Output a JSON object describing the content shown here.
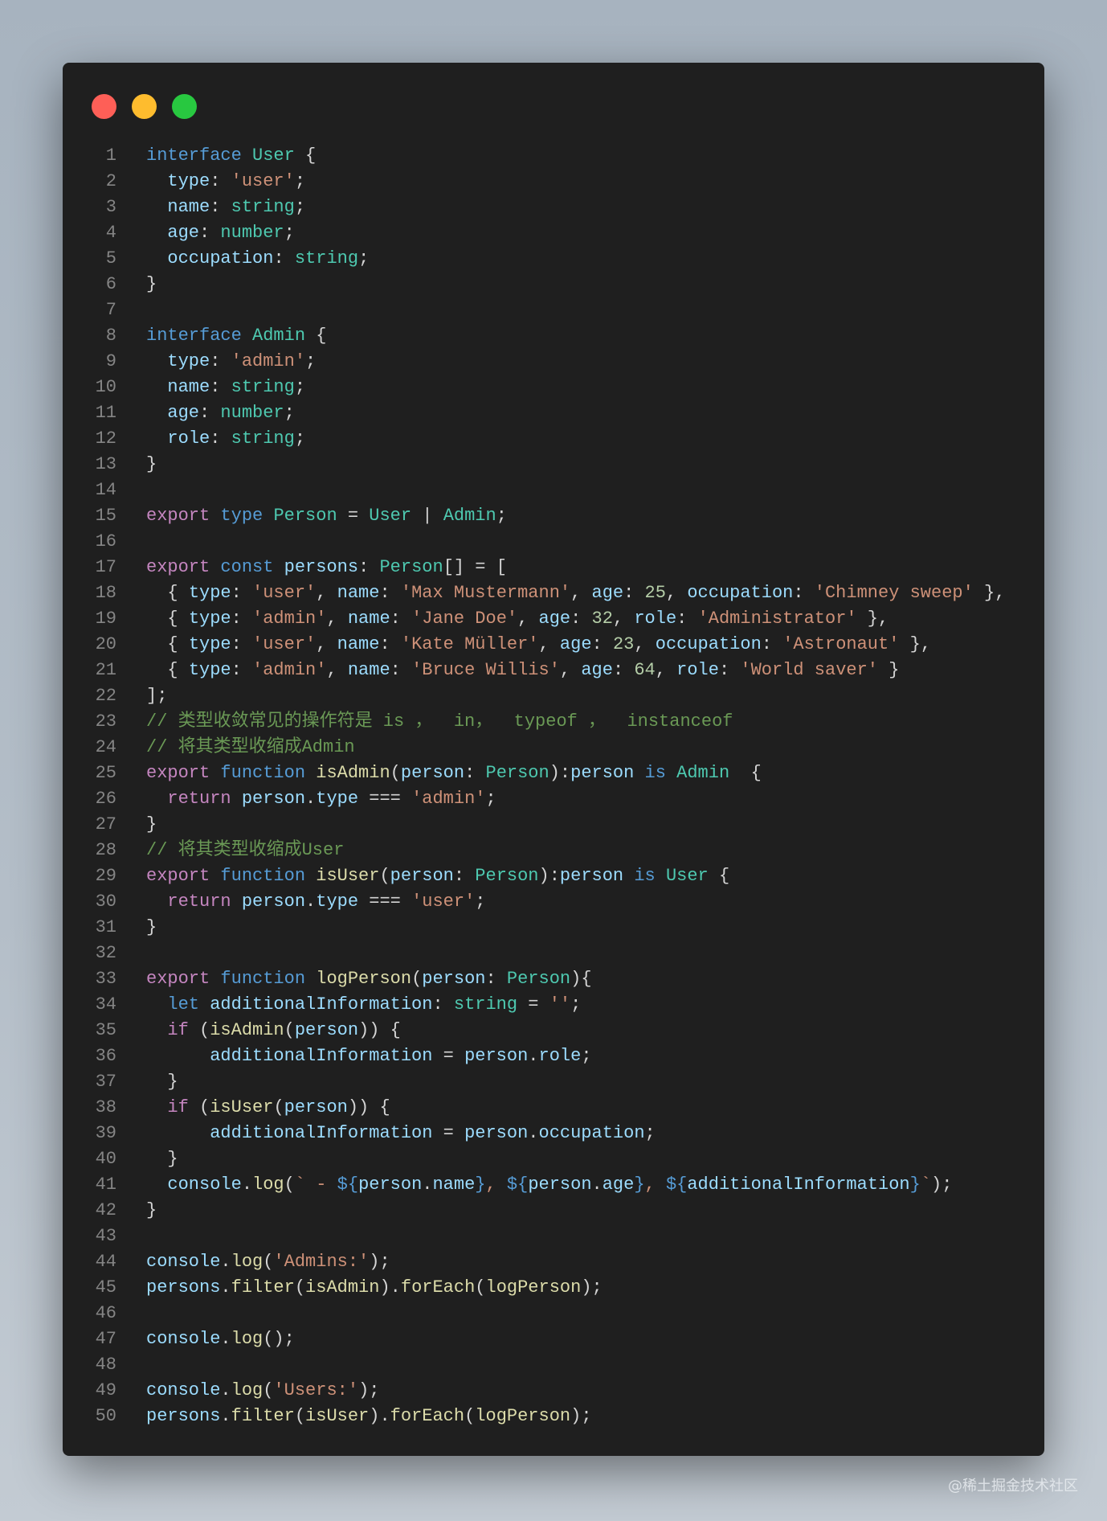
{
  "window": {
    "buttons": [
      "close",
      "minimize",
      "maximize"
    ],
    "colors": {
      "close": "#fe5f57",
      "minimize": "#febc2e",
      "maximize": "#28c840",
      "background": "#1f1f1f"
    }
  },
  "code": [
    [
      [
        "interface",
        "k"
      ],
      [
        " ",
        "x"
      ],
      [
        "User",
        "t"
      ],
      [
        " {",
        "x"
      ]
    ],
    [
      [
        "  ",
        "x"
      ],
      [
        "type",
        "p"
      ],
      [
        ": ",
        "x"
      ],
      [
        "'user'",
        "s"
      ],
      [
        ";",
        "x"
      ]
    ],
    [
      [
        "  ",
        "x"
      ],
      [
        "name",
        "p"
      ],
      [
        ": ",
        "x"
      ],
      [
        "string",
        "t"
      ],
      [
        ";",
        "x"
      ]
    ],
    [
      [
        "  ",
        "x"
      ],
      [
        "age",
        "p"
      ],
      [
        ": ",
        "x"
      ],
      [
        "number",
        "t"
      ],
      [
        ";",
        "x"
      ]
    ],
    [
      [
        "  ",
        "x"
      ],
      [
        "occupation",
        "p"
      ],
      [
        ": ",
        "x"
      ],
      [
        "string",
        "t"
      ],
      [
        ";",
        "x"
      ]
    ],
    [
      [
        "}",
        "x"
      ]
    ],
    [],
    [
      [
        "interface",
        "k"
      ],
      [
        " ",
        "x"
      ],
      [
        "Admin",
        "t"
      ],
      [
        " {",
        "x"
      ]
    ],
    [
      [
        "  ",
        "x"
      ],
      [
        "type",
        "p"
      ],
      [
        ": ",
        "x"
      ],
      [
        "'admin'",
        "s"
      ],
      [
        ";",
        "x"
      ]
    ],
    [
      [
        "  ",
        "x"
      ],
      [
        "name",
        "p"
      ],
      [
        ": ",
        "x"
      ],
      [
        "string",
        "t"
      ],
      [
        ";",
        "x"
      ]
    ],
    [
      [
        "  ",
        "x"
      ],
      [
        "age",
        "p"
      ],
      [
        ": ",
        "x"
      ],
      [
        "number",
        "t"
      ],
      [
        ";",
        "x"
      ]
    ],
    [
      [
        "  ",
        "x"
      ],
      [
        "role",
        "p"
      ],
      [
        ": ",
        "x"
      ],
      [
        "string",
        "t"
      ],
      [
        ";",
        "x"
      ]
    ],
    [
      [
        "}",
        "x"
      ]
    ],
    [],
    [
      [
        "export",
        "c"
      ],
      [
        " ",
        "x"
      ],
      [
        "type",
        "k"
      ],
      [
        " ",
        "x"
      ],
      [
        "Person",
        "t"
      ],
      [
        " = ",
        "x"
      ],
      [
        "User",
        "t"
      ],
      [
        " | ",
        "x"
      ],
      [
        "Admin",
        "t"
      ],
      [
        ";",
        "x"
      ]
    ],
    [],
    [
      [
        "export",
        "c"
      ],
      [
        " ",
        "x"
      ],
      [
        "const",
        "k"
      ],
      [
        " ",
        "x"
      ],
      [
        "persons",
        "p"
      ],
      [
        ": ",
        "x"
      ],
      [
        "Person",
        "t"
      ],
      [
        "[] = [",
        "x"
      ]
    ],
    [
      [
        "  { ",
        "x"
      ],
      [
        "type",
        "p"
      ],
      [
        ": ",
        "x"
      ],
      [
        "'user'",
        "s"
      ],
      [
        ", ",
        "x"
      ],
      [
        "name",
        "p"
      ],
      [
        ": ",
        "x"
      ],
      [
        "'Max Mustermann'",
        "s"
      ],
      [
        ", ",
        "x"
      ],
      [
        "age",
        "p"
      ],
      [
        ": ",
        "x"
      ],
      [
        "25",
        "n"
      ],
      [
        ", ",
        "x"
      ],
      [
        "occupation",
        "p"
      ],
      [
        ": ",
        "x"
      ],
      [
        "'Chimney sweep'",
        "s"
      ],
      [
        " },",
        "x"
      ]
    ],
    [
      [
        "  { ",
        "x"
      ],
      [
        "type",
        "p"
      ],
      [
        ": ",
        "x"
      ],
      [
        "'admin'",
        "s"
      ],
      [
        ", ",
        "x"
      ],
      [
        "name",
        "p"
      ],
      [
        ": ",
        "x"
      ],
      [
        "'Jane Doe'",
        "s"
      ],
      [
        ", ",
        "x"
      ],
      [
        "age",
        "p"
      ],
      [
        ": ",
        "x"
      ],
      [
        "32",
        "n"
      ],
      [
        ", ",
        "x"
      ],
      [
        "role",
        "p"
      ],
      [
        ": ",
        "x"
      ],
      [
        "'Administrator'",
        "s"
      ],
      [
        " },",
        "x"
      ]
    ],
    [
      [
        "  { ",
        "x"
      ],
      [
        "type",
        "p"
      ],
      [
        ": ",
        "x"
      ],
      [
        "'user'",
        "s"
      ],
      [
        ", ",
        "x"
      ],
      [
        "name",
        "p"
      ],
      [
        ": ",
        "x"
      ],
      [
        "'Kate Müller'",
        "s"
      ],
      [
        ", ",
        "x"
      ],
      [
        "age",
        "p"
      ],
      [
        ": ",
        "x"
      ],
      [
        "23",
        "n"
      ],
      [
        ", ",
        "x"
      ],
      [
        "occupation",
        "p"
      ],
      [
        ": ",
        "x"
      ],
      [
        "'Astronaut'",
        "s"
      ],
      [
        " },",
        "x"
      ]
    ],
    [
      [
        "  { ",
        "x"
      ],
      [
        "type",
        "p"
      ],
      [
        ": ",
        "x"
      ],
      [
        "'admin'",
        "s"
      ],
      [
        ", ",
        "x"
      ],
      [
        "name",
        "p"
      ],
      [
        ": ",
        "x"
      ],
      [
        "'Bruce Willis'",
        "s"
      ],
      [
        ", ",
        "x"
      ],
      [
        "age",
        "p"
      ],
      [
        ": ",
        "x"
      ],
      [
        "64",
        "n"
      ],
      [
        ", ",
        "x"
      ],
      [
        "role",
        "p"
      ],
      [
        ": ",
        "x"
      ],
      [
        "'World saver'",
        "s"
      ],
      [
        " }",
        "x"
      ]
    ],
    [
      [
        "];",
        "x"
      ]
    ],
    [
      [
        "// 类型收敛常见的操作符是 is ，  in，  typeof ，  instanceof",
        "m"
      ]
    ],
    [
      [
        "// 将其类型收缩成Admin",
        "m"
      ]
    ],
    [
      [
        "export",
        "c"
      ],
      [
        " ",
        "x"
      ],
      [
        "function",
        "k"
      ],
      [
        " ",
        "x"
      ],
      [
        "isAdmin",
        "f"
      ],
      [
        "(",
        "x"
      ],
      [
        "person",
        "p"
      ],
      [
        ": ",
        "x"
      ],
      [
        "Person",
        "t"
      ],
      [
        "):",
        "x"
      ],
      [
        "person",
        "p"
      ],
      [
        " ",
        "x"
      ],
      [
        "is",
        "k"
      ],
      [
        " ",
        "x"
      ],
      [
        "Admin",
        "t"
      ],
      [
        "  {",
        "x"
      ]
    ],
    [
      [
        "  ",
        "x"
      ],
      [
        "return",
        "c"
      ],
      [
        " ",
        "x"
      ],
      [
        "person",
        "p"
      ],
      [
        ".",
        "x"
      ],
      [
        "type",
        "p"
      ],
      [
        " === ",
        "x"
      ],
      [
        "'admin'",
        "s"
      ],
      [
        ";",
        "x"
      ]
    ],
    [
      [
        "}",
        "x"
      ]
    ],
    [
      [
        "// 将其类型收缩成User",
        "m"
      ]
    ],
    [
      [
        "export",
        "c"
      ],
      [
        " ",
        "x"
      ],
      [
        "function",
        "k"
      ],
      [
        " ",
        "x"
      ],
      [
        "isUser",
        "f"
      ],
      [
        "(",
        "x"
      ],
      [
        "person",
        "p"
      ],
      [
        ": ",
        "x"
      ],
      [
        "Person",
        "t"
      ],
      [
        "):",
        "x"
      ],
      [
        "person",
        "p"
      ],
      [
        " ",
        "x"
      ],
      [
        "is",
        "k"
      ],
      [
        " ",
        "x"
      ],
      [
        "User",
        "t"
      ],
      [
        " {",
        "x"
      ]
    ],
    [
      [
        "  ",
        "x"
      ],
      [
        "return",
        "c"
      ],
      [
        " ",
        "x"
      ],
      [
        "person",
        "p"
      ],
      [
        ".",
        "x"
      ],
      [
        "type",
        "p"
      ],
      [
        " === ",
        "x"
      ],
      [
        "'user'",
        "s"
      ],
      [
        ";",
        "x"
      ]
    ],
    [
      [
        "}",
        "x"
      ]
    ],
    [],
    [
      [
        "export",
        "c"
      ],
      [
        " ",
        "x"
      ],
      [
        "function",
        "k"
      ],
      [
        " ",
        "x"
      ],
      [
        "logPerson",
        "f"
      ],
      [
        "(",
        "x"
      ],
      [
        "person",
        "p"
      ],
      [
        ": ",
        "x"
      ],
      [
        "Person",
        "t"
      ],
      [
        "){",
        "x"
      ]
    ],
    [
      [
        "  ",
        "x"
      ],
      [
        "let",
        "k"
      ],
      [
        " ",
        "x"
      ],
      [
        "additionalInformation",
        "p"
      ],
      [
        ": ",
        "x"
      ],
      [
        "string",
        "t"
      ],
      [
        " = ",
        "x"
      ],
      [
        "''",
        "s"
      ],
      [
        ";",
        "x"
      ]
    ],
    [
      [
        "  ",
        "x"
      ],
      [
        "if",
        "c"
      ],
      [
        " (",
        "x"
      ],
      [
        "isAdmin",
        "f"
      ],
      [
        "(",
        "x"
      ],
      [
        "person",
        "p"
      ],
      [
        ")) {",
        "x"
      ]
    ],
    [
      [
        "      ",
        "x"
      ],
      [
        "additionalInformation",
        "p"
      ],
      [
        " = ",
        "x"
      ],
      [
        "person",
        "p"
      ],
      [
        ".",
        "x"
      ],
      [
        "role",
        "p"
      ],
      [
        ";",
        "x"
      ]
    ],
    [
      [
        "  }",
        "x"
      ]
    ],
    [
      [
        "  ",
        "x"
      ],
      [
        "if",
        "c"
      ],
      [
        " (",
        "x"
      ],
      [
        "isUser",
        "f"
      ],
      [
        "(",
        "x"
      ],
      [
        "person",
        "p"
      ],
      [
        ")) {",
        "x"
      ]
    ],
    [
      [
        "      ",
        "x"
      ],
      [
        "additionalInformation",
        "p"
      ],
      [
        " = ",
        "x"
      ],
      [
        "person",
        "p"
      ],
      [
        ".",
        "x"
      ],
      [
        "occupation",
        "p"
      ],
      [
        ";",
        "x"
      ]
    ],
    [
      [
        "  }",
        "x"
      ]
    ],
    [
      [
        "  ",
        "x"
      ],
      [
        "console",
        "p"
      ],
      [
        ".",
        "x"
      ],
      [
        "log",
        "f"
      ],
      [
        "(",
        "x"
      ],
      [
        "` - ",
        "s"
      ],
      [
        "${",
        "k"
      ],
      [
        "person",
        "p"
      ],
      [
        ".",
        "x"
      ],
      [
        "name",
        "p"
      ],
      [
        "}",
        "k"
      ],
      [
        ", ",
        "s"
      ],
      [
        "${",
        "k"
      ],
      [
        "person",
        "p"
      ],
      [
        ".",
        "x"
      ],
      [
        "age",
        "p"
      ],
      [
        "}",
        "k"
      ],
      [
        ", ",
        "s"
      ],
      [
        "${",
        "k"
      ],
      [
        "additionalInformation",
        "p"
      ],
      [
        "}",
        "k"
      ],
      [
        "`",
        "s"
      ],
      [
        ");",
        "x"
      ]
    ],
    [
      [
        "}",
        "x"
      ]
    ],
    [],
    [
      [
        "console",
        "p"
      ],
      [
        ".",
        "x"
      ],
      [
        "log",
        "f"
      ],
      [
        "(",
        "x"
      ],
      [
        "'Admins:'",
        "s"
      ],
      [
        ");",
        "x"
      ]
    ],
    [
      [
        "persons",
        "p"
      ],
      [
        ".",
        "x"
      ],
      [
        "filter",
        "f"
      ],
      [
        "(",
        "x"
      ],
      [
        "isAdmin",
        "f"
      ],
      [
        ").",
        "x"
      ],
      [
        "forEach",
        "f"
      ],
      [
        "(",
        "x"
      ],
      [
        "logPerson",
        "f"
      ],
      [
        ");",
        "x"
      ]
    ],
    [],
    [
      [
        "console",
        "p"
      ],
      [
        ".",
        "x"
      ],
      [
        "log",
        "f"
      ],
      [
        "();",
        "x"
      ]
    ],
    [],
    [
      [
        "console",
        "p"
      ],
      [
        ".",
        "x"
      ],
      [
        "log",
        "f"
      ],
      [
        "(",
        "x"
      ],
      [
        "'Users:'",
        "s"
      ],
      [
        ");",
        "x"
      ]
    ],
    [
      [
        "persons",
        "p"
      ],
      [
        ".",
        "x"
      ],
      [
        "filter",
        "f"
      ],
      [
        "(",
        "x"
      ],
      [
        "isUser",
        "f"
      ],
      [
        ").",
        "x"
      ],
      [
        "forEach",
        "f"
      ],
      [
        "(",
        "x"
      ],
      [
        "logPerson",
        "f"
      ],
      [
        ");",
        "x"
      ]
    ]
  ],
  "watermark": "@稀土掘金技术社区"
}
